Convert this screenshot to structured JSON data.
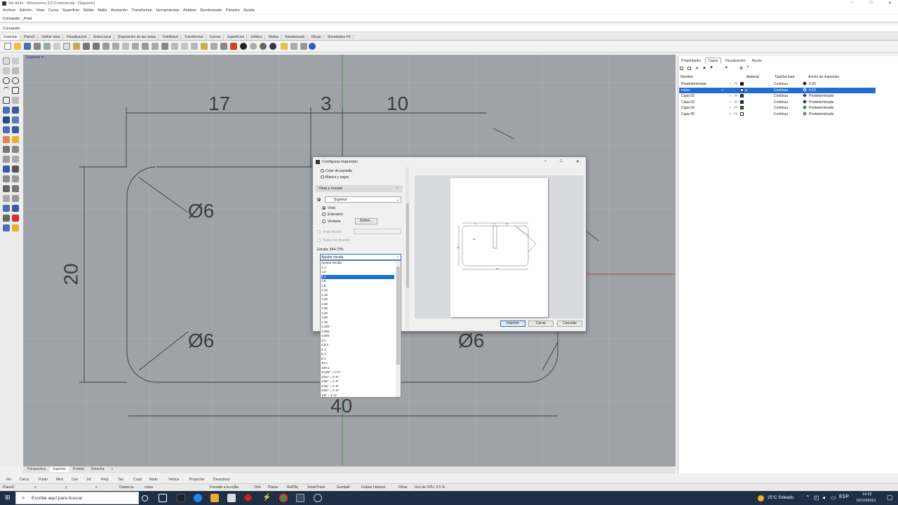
{
  "window": {
    "title": "Sin título - Rhinoceros 5.0 Commercial - [Superior]",
    "minimize": "–",
    "maximize": "□",
    "close": "✕"
  },
  "menu": [
    "Archivo",
    "Edición",
    "Vista",
    "Curva",
    "Superficie",
    "Sólido",
    "Malla",
    "Acotación",
    "Transformar",
    "Herramientas",
    "Análisis",
    "Renderizado",
    "Paneles",
    "Ayuda"
  ],
  "command_history": "Comando: _Print",
  "command_prompt": "Comando:",
  "toolbar_tabs": [
    "Estándar",
    "PlanoC",
    "Definir vista",
    "Visualización",
    "Seleccionar",
    "Disposición de las vistas",
    "Visibilidad",
    "Transformar",
    "Curvas",
    "Superficies",
    "Sólidos",
    "Mallas",
    "Renderizado",
    "Dibujo",
    "Novedades V5"
  ],
  "viewport": {
    "label": "Superior ▾",
    "dims": {
      "d17": "17",
      "d3": "3",
      "d10": "10",
      "d20": "20",
      "d40": "40",
      "phi1": "Ø6",
      "phi2": "Ø6",
      "phi3": "Ø6",
      "phi4": "Ø6"
    }
  },
  "right_panel": {
    "tabs": [
      "Propiedades",
      "Capas",
      "Visualización",
      "Ayuda"
    ],
    "columns": {
      "name": "Nombre",
      "material": "Material",
      "linetype": "TipoDeLínea",
      "printwidth": "Ancho de impresión"
    },
    "layers": [
      {
        "name": "Predeterminada",
        "color": "#000000",
        "linetype": "Continua",
        "print": "0.30",
        "selected": false
      },
      {
        "name": "cotas",
        "color": "#ffffff",
        "linetype": "Continua",
        "print": "0.13",
        "selected": true
      },
      {
        "name": "Capa 02",
        "color": "#2a2ac8",
        "linetype": "Continua",
        "print": "Predeterminado",
        "selected": false
      },
      {
        "name": "Capa 03",
        "color": "#2020a0",
        "linetype": "Continua",
        "print": "Predeterminado",
        "selected": false
      },
      {
        "name": "Capa 04",
        "color": "#1a8a1a",
        "linetype": "Continua",
        "print": "Predeterminado",
        "selected": false
      },
      {
        "name": "Capa 05",
        "color": "#ffffff",
        "linetype": "Continua",
        "print": "Predeterminado",
        "selected": false
      }
    ]
  },
  "dialog": {
    "title": "Configurar impresión",
    "opt_color": "Color de pantalla",
    "opt_bw": "Blanco y negro",
    "section": "Vista y escala",
    "view_select": "Superior",
    "r_vista": "Vista",
    "r_extension": "Extensión",
    "r_ventana": "Ventana",
    "define_btn": "Definir...",
    "r_viewport": "Vista diseño",
    "r_all": "Todos los diseños",
    "scale_label": "Escala: 344.73%",
    "scale_value": "Ajustar escala",
    "scale_options": [
      "Ajustar escala",
      "1:1",
      "1:2",
      "1:4",
      "1:5",
      "1:8",
      "1:10",
      "1:16",
      "1:20",
      "1:25",
      "1:30",
      "1:40",
      "1:50",
      "1:75",
      "1:100",
      "1:200",
      "1:500",
      "2:1",
      "2.5:1",
      "4:1",
      "5:1",
      "8:1",
      "10:1",
      "100:1",
      "1/128\" = 1'-0\"",
      "1/64\" = 1'-0\"",
      "1/32\" = 1'-0\"",
      "1/16\" = 1'-0\"",
      "3/32\" = 1'-0\"",
      "1/8\" = 1'-0\""
    ],
    "selected_option": "1:4",
    "btn_print": "Imprimir",
    "btn_close": "Cerrar",
    "btn_cancel": "Cancelar",
    "preview_dims": {
      "a": "17",
      "b": "3",
      "c": "10",
      "d": "20",
      "e": "40",
      "f": "Ø6"
    }
  },
  "viewport_tabs": [
    "Perspectiva",
    "Superior",
    "Frontal",
    "Derecha",
    "+"
  ],
  "osnaps": [
    "Fin",
    "Cerca",
    "Punto",
    "Med",
    "Cen",
    "Int",
    "Perp",
    "Tan",
    "Cuad",
    "Nodo",
    "Vértice",
    "Proyectar",
    "Desactivar"
  ],
  "status": {
    "plane": "PlanoC",
    "x": "x",
    "y": "y",
    "z": "z",
    "distance": "Distancia",
    "layer": "cotas",
    "items": [
      "Forzado a la rejilla",
      "Orto",
      "Planar",
      "RefObj",
      "SmartTrack",
      "Gumball",
      "Grabar historial",
      "Filtrar"
    ],
    "cpu": "Uso de CPU: 0.5 %"
  },
  "taskbar": {
    "search": "Escribe aquí para buscar",
    "weather": "25°C Soleado",
    "time": "14:22",
    "date": "02/10/2021"
  }
}
